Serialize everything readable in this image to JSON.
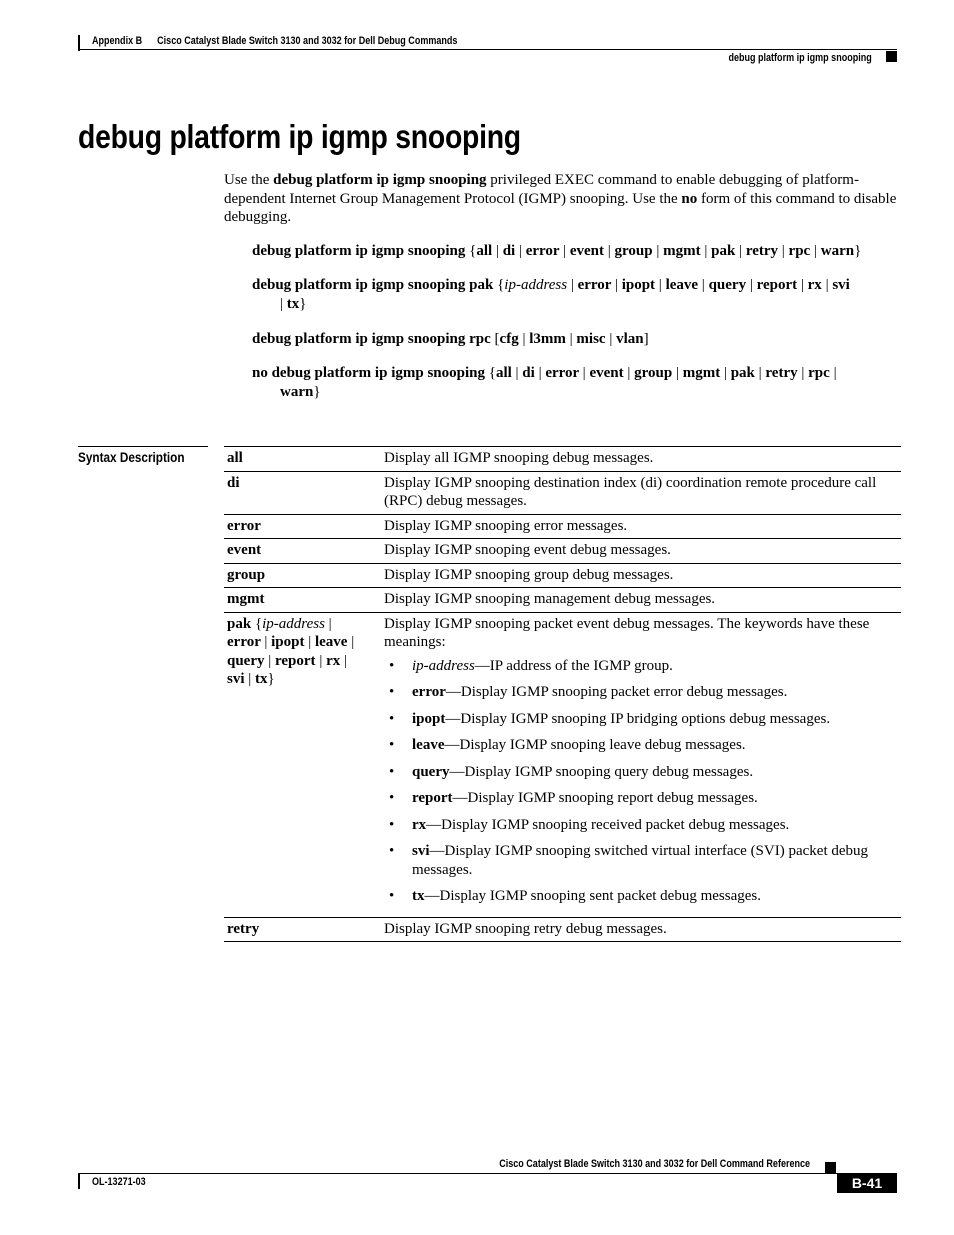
{
  "header": {
    "appendix": "Appendix B",
    "chapter": "Cisco Catalyst Blade Switch 3130 and 3032 for Dell Debug Commands",
    "section": "debug platform ip igmp snooping"
  },
  "title": "debug platform ip igmp snooping",
  "intro": {
    "p1": "Use the ",
    "cmd": "debug platform ip igmp snooping",
    "p2": " privileged EXEC command to enable debugging of platform-dependent Internet Group Management Protocol (IGMP) snooping. Use the ",
    "no": "no",
    "p3": " form of this command to disable debugging."
  },
  "syntax": [
    "debug platform ip igmp snooping {all | di | error | event | group | mgmt | pak | retry | rpc | warn}",
    "debug platform ip igmp snooping pak {ip-address | error | ipopt | leave | query | report | rx | svi | tx}",
    "debug platform ip igmp snooping rpc [cfg | l3mm | misc | vlan]",
    "no debug platform ip igmp snooping {all | di | error | event | group | mgmt | pak | retry | rpc | warn}"
  ],
  "syntax_description": {
    "label": "Syntax Description",
    "rows": [
      {
        "keyword": "all",
        "description": "Display all IGMP snooping debug messages."
      },
      {
        "keyword": "di",
        "description": "Display IGMP snooping destination index (di) coordination remote procedure call (RPC) debug messages."
      },
      {
        "keyword": "error",
        "description": "Display IGMP snooping error messages."
      },
      {
        "keyword": "event",
        "description": "Display IGMP snooping event debug messages."
      },
      {
        "keyword": "group",
        "description": "Display IGMP snooping group debug messages."
      },
      {
        "keyword": "mgmt",
        "description": "Display IGMP snooping management debug messages."
      },
      {
        "keyword": "pak {ip-address | error | ipopt | leave | query | report | rx | svi | tx}",
        "description": "Display IGMP snooping packet event debug messages. The keywords have these meanings:",
        "bullets": [
          {
            "term": "ip-address",
            "text": "—IP address of the IGMP group."
          },
          {
            "term": "error",
            "text": "—Display IGMP snooping packet error debug messages."
          },
          {
            "term": "ipopt",
            "text": "—Display IGMP snooping IP bridging options debug messages."
          },
          {
            "term": "leave",
            "text": "—Display IGMP snooping leave debug messages."
          },
          {
            "term": "query",
            "text": "—Display IGMP snooping query debug messages."
          },
          {
            "term": "report",
            "text": "—Display IGMP snooping report debug messages."
          },
          {
            "term": "rx",
            "text": "—Display IGMP snooping received packet debug messages."
          },
          {
            "term": "svi",
            "text": "—Display IGMP snooping switched virtual interface (SVI) packet debug messages."
          },
          {
            "term": "tx",
            "text": "—Display IGMP snooping sent packet debug messages."
          }
        ]
      },
      {
        "keyword": "retry",
        "description": "Display IGMP snooping retry debug messages."
      }
    ]
  },
  "footer": {
    "book_title": "Cisco Catalyst Blade Switch 3130 and 3032 for Dell Command Reference",
    "doc_number": "OL-13271-03",
    "page": "B-41"
  }
}
